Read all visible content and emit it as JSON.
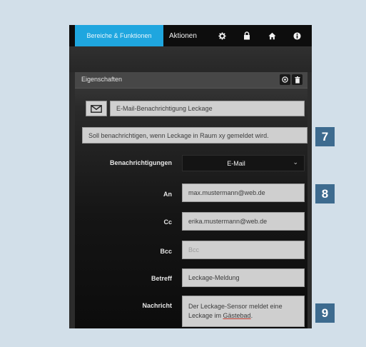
{
  "nav": {
    "active_tab": "Bereiche & Funktionen",
    "tab_actions": "Aktionen",
    "icons": [
      "gear-icon",
      "lock-icon",
      "home-icon",
      "info-icon"
    ]
  },
  "panel": {
    "title": "Eigenschaften",
    "header_icons": [
      "settings-icon",
      "trash-icon"
    ],
    "name_value": "E-Mail-Benachrichtigung Leckage",
    "description_value": "Soll benachrichtigen, wenn Leckage in Raum xy gemeldet wird.",
    "notifications_label": "Benachrichtigungen",
    "notifications_value": "E-Mail",
    "to_label": "An",
    "to_value": "max.mustermann@web.de",
    "cc_label": "Cc",
    "cc_value": "erika.mustermann@web.de",
    "bcc_label": "Bcc",
    "bcc_placeholder": "Bcc",
    "subject_label": "Betreff",
    "subject_value": "Leckage-Meldung",
    "message_label": "Nachricht",
    "message_line1": "Der Leckage-Sensor meldet eine",
    "message_line2_prefix": "Leckage im ",
    "message_line2_word": "Gästebad",
    "message_line2_suffix": "."
  },
  "badges": [
    "7",
    "8",
    "9"
  ],
  "colors": {
    "accent": "#1fa6df",
    "badge": "#3d6b8f",
    "frame": "#d2dfe9"
  }
}
